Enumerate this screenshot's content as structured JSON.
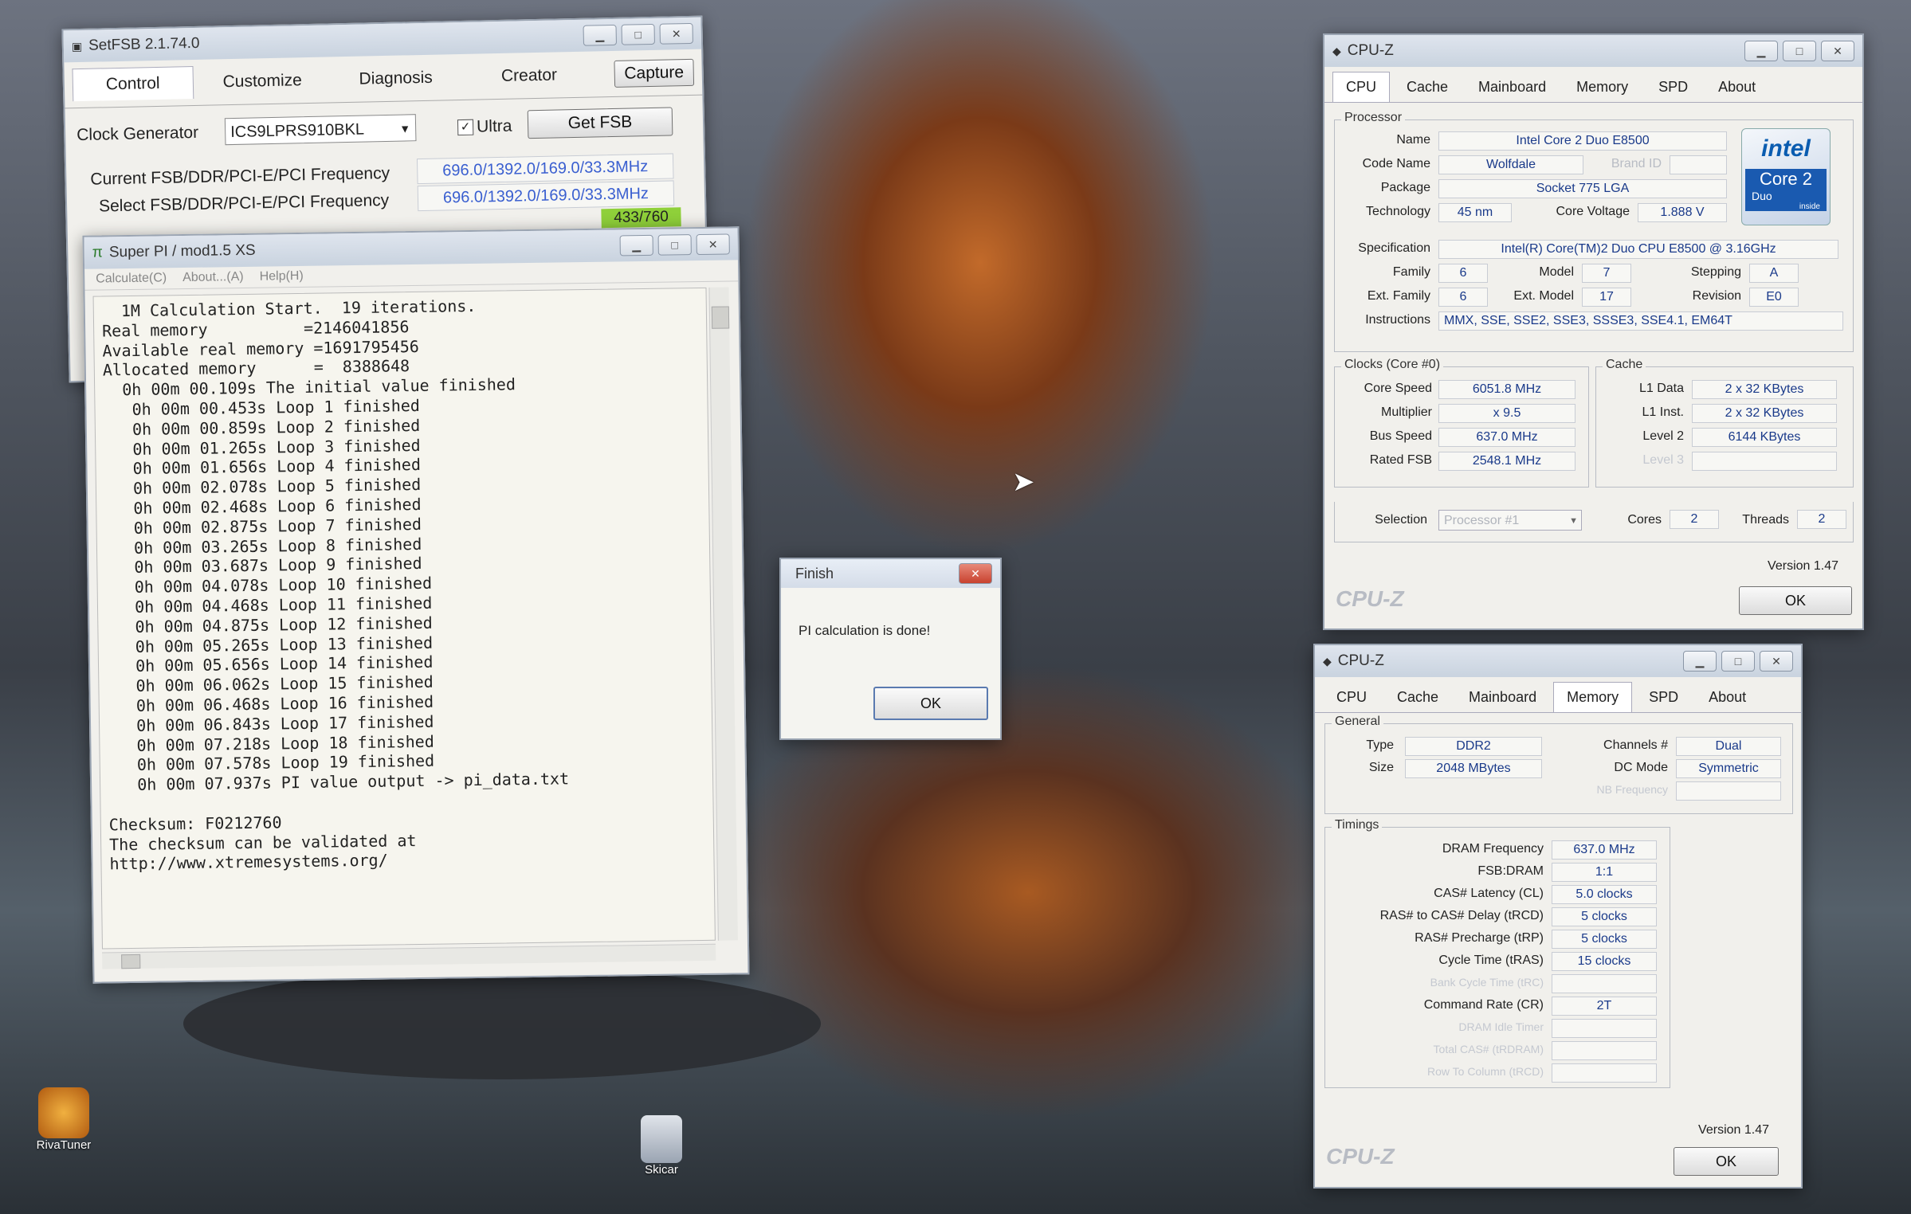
{
  "desktop": {
    "icons": [
      {
        "label": "RivaTuner",
        "icon": "rivatuner-icon"
      },
      {
        "label": "Skicar",
        "icon": "skicar-icon"
      }
    ]
  },
  "setfsb": {
    "title": "SetFSB 2.1.74.0",
    "tabs": [
      "Control",
      "Customize",
      "Diagnosis",
      "Creator"
    ],
    "capture_label": "Capture",
    "clock_generator_label": "Clock Generator",
    "clock_generator_value": "ICS9LPRS910BKL",
    "ultra_label": "Ultra",
    "ultra_checked": true,
    "get_fsb_label": "Get FSB",
    "current_label": "Current FSB/DDR/PCI-E/PCI Frequency",
    "current_value": "696.0/1392.0/169.0/33.3MHz",
    "select_label": "Select FSB/DDR/PCI-E/PCI Frequency",
    "select_value": "696.0/1392.0/169.0/33.3MHz",
    "slider_value": "433/760"
  },
  "superpi": {
    "title": "Super PI / mod1.5 XS",
    "menu": [
      "Calculate(C)",
      "About...(A)",
      "Help(H)"
    ],
    "output_lines": [
      "  1M Calculation Start.  19 iterations.",
      "Real memory          =2146041856",
      "Available real memory =1691795456",
      "Allocated memory      =  8388648",
      "  0h 00m 00.109s The initial value finished",
      "   0h 00m 00.453s Loop 1 finished",
      "   0h 00m 00.859s Loop 2 finished",
      "   0h 00m 01.265s Loop 3 finished",
      "   0h 00m 01.656s Loop 4 finished",
      "   0h 00m 02.078s Loop 5 finished",
      "   0h 00m 02.468s Loop 6 finished",
      "   0h 00m 02.875s Loop 7 finished",
      "   0h 00m 03.265s Loop 8 finished",
      "   0h 00m 03.687s Loop 9 finished",
      "   0h 00m 04.078s Loop 10 finished",
      "   0h 00m 04.468s Loop 11 finished",
      "   0h 00m 04.875s Loop 12 finished",
      "   0h 00m 05.265s Loop 13 finished",
      "   0h 00m 05.656s Loop 14 finished",
      "   0h 00m 06.062s Loop 15 finished",
      "   0h 00m 06.468s Loop 16 finished",
      "   0h 00m 06.843s Loop 17 finished",
      "   0h 00m 07.218s Loop 18 finished",
      "   0h 00m 07.578s Loop 19 finished",
      "   0h 00m 07.937s PI value output -> pi_data.txt",
      "",
      "Checksum: F0212760",
      "The checksum can be validated at",
      "http://www.xtremesystems.org/"
    ]
  },
  "finish_dialog": {
    "title": "Finish",
    "message": "PI calculation is done!",
    "ok_label": "OK"
  },
  "cpuz_cpu": {
    "title": "CPU-Z",
    "tabs": [
      "CPU",
      "Cache",
      "Mainboard",
      "Memory",
      "SPD",
      "About"
    ],
    "processor_legend": "Processor",
    "name_label": "Name",
    "name": "Intel Core 2 Duo E8500",
    "codename_label": "Code Name",
    "codename": "Wolfdale",
    "brandid_label": "Brand ID",
    "package_label": "Package",
    "package": "Socket 775 LGA",
    "technology_label": "Technology",
    "technology": "45 nm",
    "corevoltage_label": "Core Voltage",
    "corevoltage": "1.888 V",
    "spec_label": "Specification",
    "spec": "Intel(R) Core(TM)2 Duo CPU     E8500  @ 3.16GHz",
    "family_label": "Family",
    "family": "6",
    "model_label": "Model",
    "model": "7",
    "stepping_label": "Stepping",
    "stepping": "A",
    "extfamily_label": "Ext. Family",
    "extfamily": "6",
    "extmodel_label": "Ext. Model",
    "extmodel": "17",
    "revision_label": "Revision",
    "revision": "E0",
    "instructions_label": "Instructions",
    "instructions": "MMX, SSE, SSE2, SSE3, SSSE3, SSE4.1, EM64T",
    "clocks_legend": "Clocks (Core #0)",
    "corespeed_label": "Core Speed",
    "corespeed": "6051.8 MHz",
    "multiplier_label": "Multiplier",
    "multiplier": "x 9.5",
    "busspeed_label": "Bus Speed",
    "busspeed": "637.0 MHz",
    "ratedfsb_label": "Rated FSB",
    "ratedfsb": "2548.1 MHz",
    "cache_legend": "Cache",
    "l1data_label": "L1 Data",
    "l1data": "2 x 32 KBytes",
    "l1inst_label": "L1 Inst.",
    "l1inst": "2 x 32 KBytes",
    "level2_label": "Level 2",
    "level2": "6144 KBytes",
    "level3_label": "Level 3",
    "selection_label": "Selection",
    "selection": "Processor #1",
    "cores_label": "Cores",
    "cores": "2",
    "threads_label": "Threads",
    "threads": "2",
    "version": "Version 1.47",
    "brand": "CPU-Z",
    "ok_label": "OK",
    "logo_text": "intel",
    "logo_sub": "Core 2",
    "logo_duo": "Duo",
    "logo_inside": "inside"
  },
  "cpuz_mem": {
    "title": "CPU-Z",
    "tabs": [
      "CPU",
      "Cache",
      "Mainboard",
      "Memory",
      "SPD",
      "About"
    ],
    "general_legend": "General",
    "type_label": "Type",
    "type": "DDR2",
    "size_label": "Size",
    "size": "2048 MBytes",
    "channels_label": "Channels #",
    "channels": "Dual",
    "dcmode_label": "DC Mode",
    "dcmode": "Symmetric",
    "nbfreq_label": "NB Frequency",
    "timings_legend": "Timings",
    "dram_label": "DRAM Frequency",
    "dram": "637.0 MHz",
    "fsbdram_label": "FSB:DRAM",
    "fsbdram": "1:1",
    "cas_label": "CAS# Latency (CL)",
    "cas": "5.0 clocks",
    "rcd_label": "RAS# to CAS# Delay (tRCD)",
    "rcd": "5 clocks",
    "rp_label": "RAS# Precharge (tRP)",
    "rp": "5 clocks",
    "ras_label": "Cycle Time (tRAS)",
    "ras": "15 clocks",
    "rc_label": "Bank Cycle Time (tRC)",
    "cr_label": "Command Rate (CR)",
    "cr": "2T",
    "idle_label": "DRAM Idle Timer",
    "trdram_label": "Total CAS# (tRDRAM)",
    "rowcol_label": "Row To Column (tRCD)",
    "version": "Version 1.47",
    "brand": "CPU-Z",
    "ok_label": "OK"
  }
}
